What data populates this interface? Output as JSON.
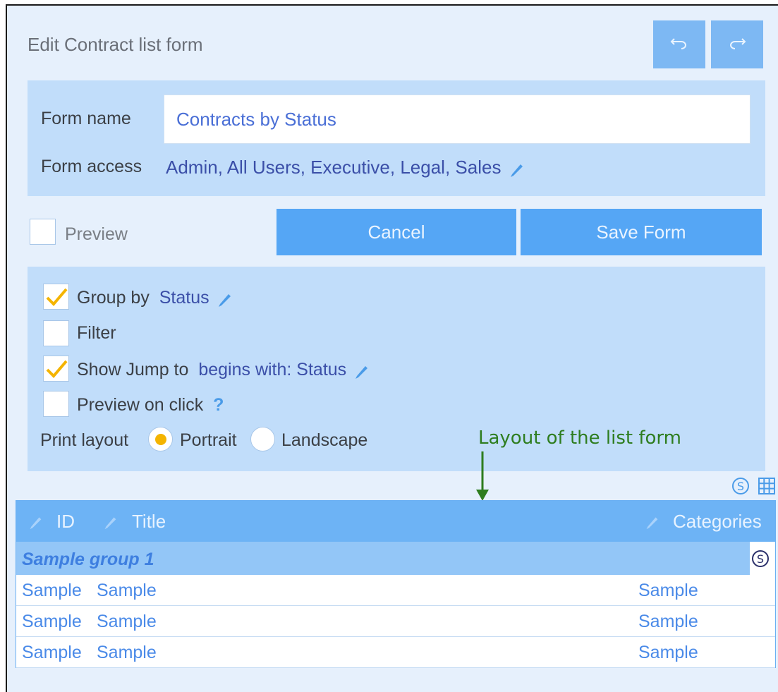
{
  "header": {
    "title": "Edit Contract list form"
  },
  "form": {
    "name_label": "Form name",
    "name_value": "Contracts by Status",
    "access_label": "Form access",
    "access_value": "Admin, All Users, Executive, Legal, Sales"
  },
  "actions": {
    "preview_label": "Preview",
    "cancel_label": "Cancel",
    "save_label": "Save Form"
  },
  "options": {
    "group_by_label": "Group by",
    "group_by_value": "Status",
    "group_by_checked": true,
    "filter_label": "Filter",
    "filter_checked": false,
    "jump_label": "Show Jump to",
    "jump_value": "begins with: Status",
    "jump_checked": true,
    "preview_click_label": "Preview on click",
    "preview_click_checked": false,
    "help_glyph": "?",
    "print_layout_label": "Print layout",
    "portrait_label": "Portrait",
    "landscape_label": "Landscape",
    "print_layout_selected": "Portrait"
  },
  "annotation": {
    "text": "Layout of the list form"
  },
  "table": {
    "columns": [
      "ID",
      "Title",
      "Categories"
    ],
    "group_label": "Sample group 1",
    "rows": [
      [
        "Sample",
        "Sample",
        "Sample"
      ],
      [
        "Sample",
        "Sample",
        "Sample"
      ],
      [
        "Sample",
        "Sample",
        "Sample"
      ]
    ]
  },
  "colors": {
    "accent": "#55a6f5",
    "panel": "#c1ddfa",
    "background": "#e6f0fc",
    "check": "#f4b400",
    "annotation": "#2e7d1f"
  },
  "icons": [
    "undo-icon",
    "redo-icon",
    "pencil-icon",
    "checkmark-icon",
    "sum-icon",
    "grid-icon",
    "down-arrow-icon"
  ]
}
